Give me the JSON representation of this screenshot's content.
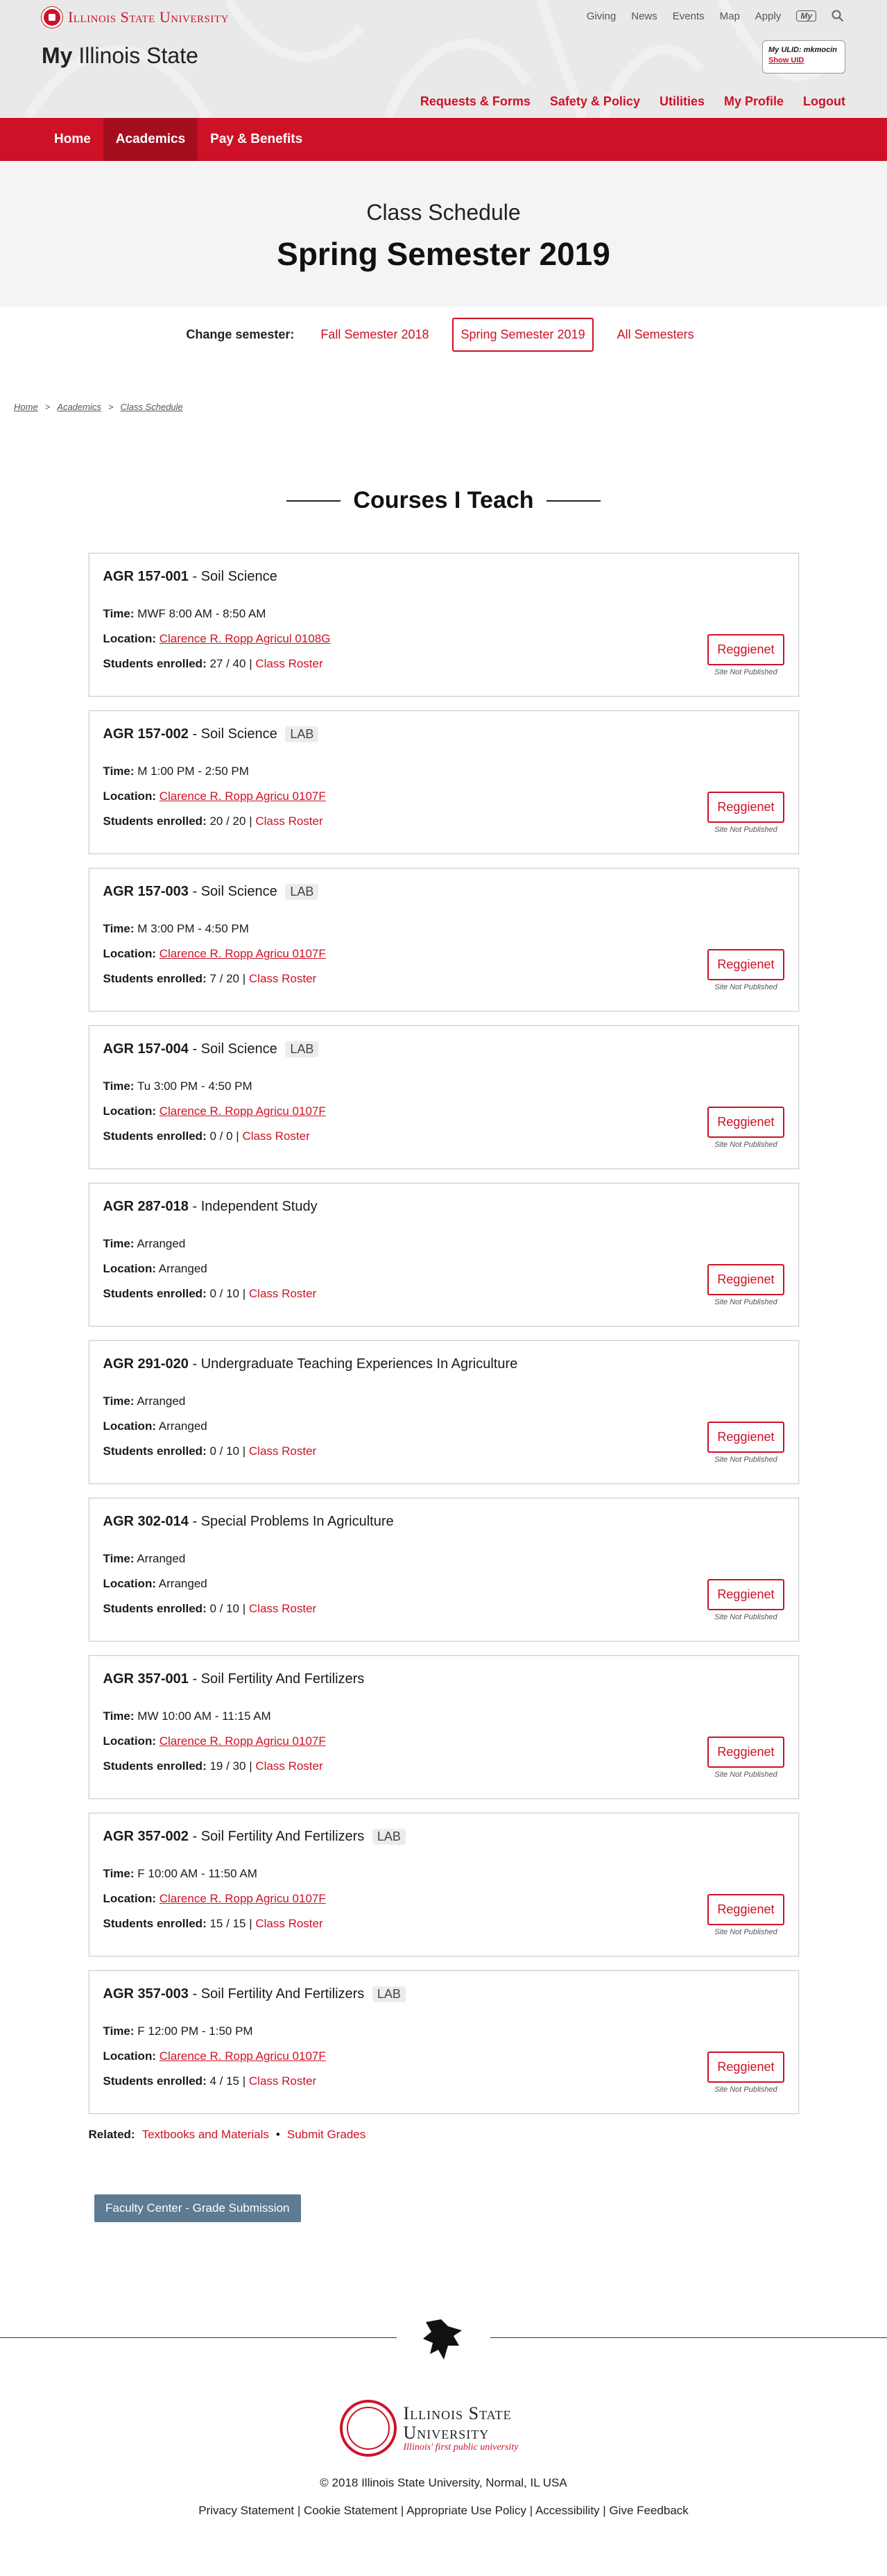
{
  "header": {
    "university_name": "Illinois State University",
    "top_links": [
      "Giving",
      "News",
      "Events",
      "Map",
      "Apply"
    ],
    "my_badge": "My",
    "site_title_bold": "My",
    "site_title_rest": "Illinois State",
    "uid_label": "My ULID: mkmocin",
    "uid_link": "Show UID",
    "utility_nav": [
      "Requests & Forms",
      "Safety & Policy",
      "Utilities",
      "My Profile",
      "Logout"
    ]
  },
  "main_nav": [
    "Home",
    "Academics",
    "Pay & Benefits"
  ],
  "hero": {
    "eyebrow": "Class Schedule",
    "title": "Spring Semester 2019"
  },
  "semester_switch": {
    "label": "Change semester:",
    "options": [
      "Fall Semester 2018",
      "Spring Semester 2019",
      "All Semesters"
    ]
  },
  "breadcrumb": [
    "Home",
    "Academics",
    "Class Schedule"
  ],
  "section_title": "Courses I Teach",
  "labels": {
    "time": "Time:",
    "location": "Location:",
    "enrolled": "Students enrolled:",
    "roster": "Class Roster",
    "reggienet": "Reggienet",
    "site_status": "Site Not Published"
  },
  "courses": [
    {
      "code": "AGR 157-001",
      "name": "Soil Science",
      "lab": "",
      "time": "MWF 8:00 AM - 8:50 AM",
      "location": "Clarence R. Ropp Agricul 0108G",
      "enrolled": "27 / 40"
    },
    {
      "code": "AGR 157-002",
      "name": "Soil Science",
      "lab": "LAB",
      "time": "M 1:00 PM - 2:50 PM",
      "location": "Clarence R. Ropp Agricu 0107F",
      "enrolled": "20 / 20"
    },
    {
      "code": "AGR 157-003",
      "name": "Soil Science",
      "lab": "LAB",
      "time": "M 3:00 PM - 4:50 PM",
      "location": "Clarence R. Ropp Agricu 0107F",
      "enrolled": "7 / 20"
    },
    {
      "code": "AGR 157-004",
      "name": "Soil Science",
      "lab": "LAB",
      "time": "Tu 3:00 PM - 4:50 PM",
      "location": "Clarence R. Ropp Agricu 0107F",
      "enrolled": "0 / 0"
    },
    {
      "code": "AGR 287-018",
      "name": "Independent Study",
      "lab": "",
      "time": "Arranged",
      "location": "Arranged",
      "enrolled": "0 / 10"
    },
    {
      "code": "AGR 291-020",
      "name": "Undergraduate Teaching Experiences In Agriculture",
      "lab": "",
      "time": "Arranged",
      "location": "Arranged",
      "enrolled": "0 / 10"
    },
    {
      "code": "AGR 302-014",
      "name": "Special Problems In Agriculture",
      "lab": "",
      "time": "Arranged",
      "location": "Arranged",
      "enrolled": "0 / 10"
    },
    {
      "code": "AGR 357-001",
      "name": "Soil Fertility And Fertilizers",
      "lab": "",
      "time": "MW 10:00 AM - 11:15 AM",
      "location": "Clarence R. Ropp Agricu 0107F",
      "enrolled": "19 / 30"
    },
    {
      "code": "AGR 357-002",
      "name": "Soil Fertility And Fertilizers",
      "lab": "LAB",
      "time": "F 10:00 AM - 11:50 AM",
      "location": "Clarence R. Ropp Agricu 0107F",
      "enrolled": "15 / 15"
    },
    {
      "code": "AGR 357-003",
      "name": "Soil Fertility And Fertilizers",
      "lab": "LAB",
      "time": "F 12:00 PM - 1:50 PM",
      "location": "Clarence R. Ropp Agricu 0107F",
      "enrolled": "4 / 15"
    }
  ],
  "related": {
    "label": "Related:",
    "links": [
      "Textbooks and Materials",
      "Submit Grades"
    ],
    "separator": "•"
  },
  "faculty_button": "Faculty Center - Grade Submission",
  "footer": {
    "wordmark_line1": "Illinois State",
    "wordmark_line2": "University",
    "tagline": "Illinois' first public university",
    "copyright": "© 2018 Illinois State University, Normal, IL USA",
    "links": [
      "Privacy Statement",
      "Cookie Statement",
      "Appropriate Use Policy",
      "Accessibility",
      "Give Feedback"
    ]
  },
  "colors": {
    "brand_red": "#ce1126",
    "nav_active": "#a50e1f",
    "faculty_button": "#5d7b93"
  }
}
